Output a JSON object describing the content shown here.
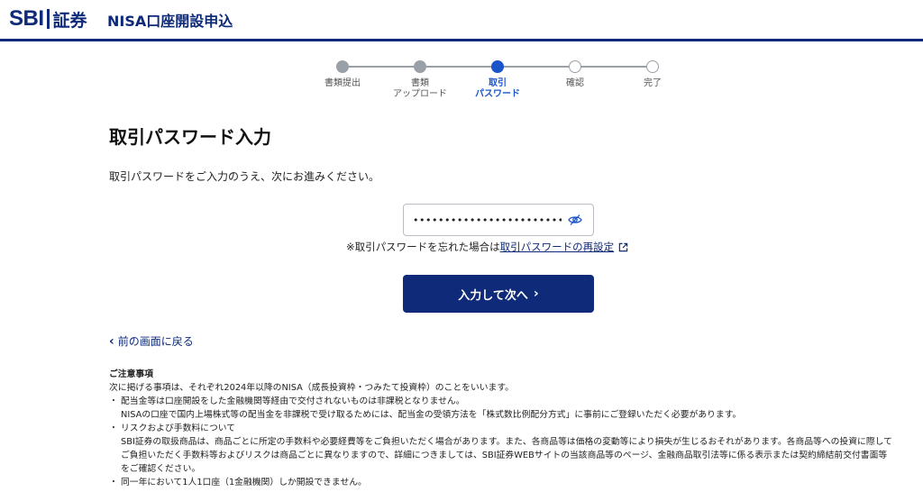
{
  "header": {
    "logo_brand": "SBI",
    "logo_suffix": "証券",
    "title": "NISA口座開設申込"
  },
  "steps": [
    {
      "label_line1": "書類提出",
      "label_line2": "",
      "state": "done"
    },
    {
      "label_line1": "書類",
      "label_line2": "アップロード",
      "state": "done"
    },
    {
      "label_line1": "取引",
      "label_line2": "パスワード",
      "state": "current"
    },
    {
      "label_line1": "確認",
      "label_line2": "",
      "state": "todo"
    },
    {
      "label_line1": "完了",
      "label_line2": "",
      "state": "todo"
    }
  ],
  "main": {
    "title": "取引パスワード入力",
    "instruction": "取引パスワードをご入力のうえ、次にお進みください。",
    "password_value": "••••••••••••••••••••••••",
    "password_icon": "eye-slash-icon",
    "forgot_prefix": "※取引パスワードを忘れた場合は",
    "forgot_link": "取引パスワードの再設定",
    "next_button": "入力して次へ",
    "back_link": "前の画面に戻る"
  },
  "notes": {
    "title": "ご注意事項",
    "intro": "次に掲げる事項は、それぞれ2024年以降のNISA（成長投資枠・つみたて投資枠）のことをいいます。",
    "items": [
      {
        "bullet": "・",
        "lines": [
          "配当金等は口座開設をした金融機関等経由で交付されないものは非課税となりません。",
          "NISAの口座で国内上場株式等の配当金を非課税で受け取るためには、配当金の受領方法を「株式数比例配分方式」に事前にご登録いただく必要があります。"
        ]
      },
      {
        "bullet": "・",
        "lines": [
          "リスクおよび手数料について",
          "SBI証券の取扱商品は、商品ごとに所定の手数料や必要経費等をご負担いただく場合があります。また、各商品等は価格の変動等により損失が生じるおそれがあります。各商品等への投資に際してご負担いただく手数料等およびリスクは商品ごとに異なりますので、詳細につきましては、SBI証券WEBサイトの当該商品等のページ、金融商品取引法等に係る表示または契約締結前交付書面等をご確認ください。"
        ]
      },
      {
        "bullet": "・",
        "lines": [
          "同一年において1人1口座（1金融機関）しか開設できません。"
        ]
      }
    ]
  },
  "colors": {
    "brand": "#0e2a78",
    "accent": "#1a56c9",
    "step_inactive": "#9aa0a8"
  }
}
